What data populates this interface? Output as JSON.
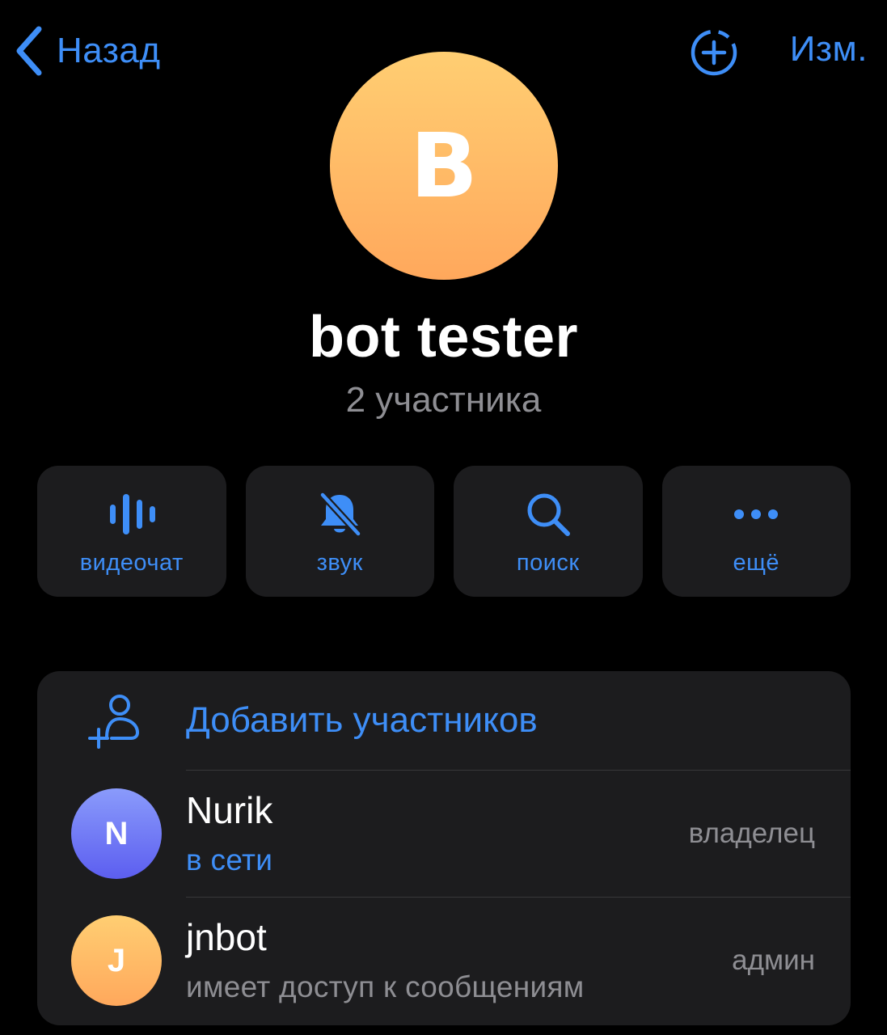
{
  "nav": {
    "back_label": "Назад",
    "edit_label": "Изм."
  },
  "group": {
    "avatar_letter": "B",
    "name": "bot tester",
    "members_count": "2 участника"
  },
  "actions": [
    {
      "label": "видеочат",
      "icon": "voice-chat-icon"
    },
    {
      "label": "звук",
      "icon": "bell-slash-icon"
    },
    {
      "label": "поиск",
      "icon": "search-icon"
    },
    {
      "label": "ещё",
      "icon": "more-icon"
    }
  ],
  "members_section": {
    "add_label": "Добавить участников",
    "members": [
      {
        "initial": "N",
        "name": "Nurik",
        "status": "в сети",
        "role": "владелец"
      },
      {
        "initial": "J",
        "name": "jnbot",
        "status": "имеет доступ к сообщениям",
        "role": "админ"
      }
    ]
  },
  "colors": {
    "accent": "#3e8ef7",
    "background": "#000000",
    "card": "#1c1c1e",
    "secondary_text": "#8e8e93",
    "group_avatar_gradient": [
      "#ffce72",
      "#ffa85c"
    ],
    "nurik_avatar_gradient": [
      "#8a9bfb",
      "#5c5ef0"
    ],
    "jnbot_avatar_gradient": [
      "#ffce72",
      "#ffa85c"
    ]
  }
}
